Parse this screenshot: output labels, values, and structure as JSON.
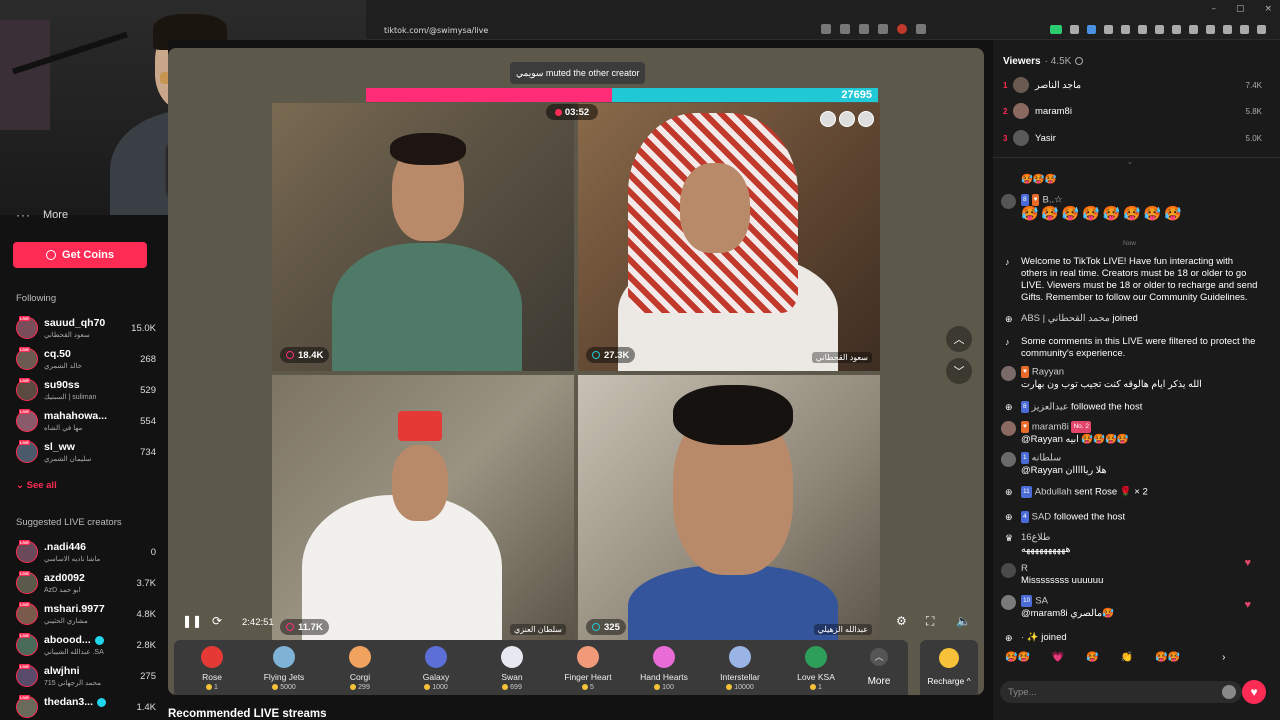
{
  "browser": {
    "url": "tiktok.com/@swimysa/live",
    "minimize": "–",
    "restore": "▢",
    "close": "×"
  },
  "sidebar": {
    "more_label": "More",
    "get_coins": "Get Coins",
    "following_title": "Following",
    "following": [
      {
        "name": "sauud_qh70",
        "sub": "سعود القحطاني",
        "count": "15.0K"
      },
      {
        "name": "cq.50",
        "sub": "خالد الشمري",
        "count": "268"
      },
      {
        "name": "su90ss",
        "sub": "السبتيك | suliman",
        "count": "529"
      },
      {
        "name": "mahahowa...",
        "sub": "مها في الشاه",
        "count": "554"
      },
      {
        "name": "sl_ww",
        "sub": "سليمان الشمري",
        "count": "734"
      }
    ],
    "see_all": "See all",
    "suggested_title": "Suggested LIVE creators",
    "suggested": [
      {
        "name": ".nadi446",
        "sub": "ماشا ناديه الاساسي",
        "count": "0"
      },
      {
        "name": "azd0092",
        "sub": "AzD ابو حمد",
        "count": "3.7K"
      },
      {
        "name": "mshari.9977",
        "sub": "مشاري الحثيني",
        "count": "4.8K"
      },
      {
        "name": "aboood...",
        "sub": "عبدالله الشيباني .SA",
        "count": "2.8K"
      },
      {
        "name": "alwjhni",
        "sub": "715 محمد الرجهاني",
        "count": "275"
      },
      {
        "name": "thedan3...",
        "sub": "",
        "count": "1.4K"
      }
    ]
  },
  "live": {
    "muted_tip": "سويمي muted the other creator",
    "right_score": "27695",
    "timer": "03:52",
    "cells": [
      {
        "viewers": "18.4K",
        "tag": ""
      },
      {
        "viewers": "27.3K",
        "tag": "سعود القحطاني"
      },
      {
        "viewers": "11.7K",
        "tag": "سلطان العنزي"
      },
      {
        "viewers": "325",
        "tag": "عبدالله الزهيلي"
      }
    ],
    "elapsed": "2:42:51",
    "gifts": [
      {
        "name": "Rose",
        "price": "1",
        "color": "#e53935"
      },
      {
        "name": "Flying Jets",
        "price": "5000",
        "color": "#7fb3d5"
      },
      {
        "name": "Corgi",
        "price": "299",
        "color": "#f0a35e"
      },
      {
        "name": "Galaxy",
        "price": "1000",
        "color": "#5b6fd6"
      },
      {
        "name": "Swan",
        "price": "699",
        "color": "#e8e8f0"
      },
      {
        "name": "Finger Heart",
        "price": "5",
        "color": "#f09a7a"
      },
      {
        "name": "Hand Hearts",
        "price": "100",
        "color": "#e86bd6"
      },
      {
        "name": "Interstellar",
        "price": "10000",
        "color": "#9ab4e6"
      },
      {
        "name": "Love KSA",
        "price": "1",
        "color": "#2e9e5b"
      }
    ],
    "more_label": "More",
    "recharge_label": "Recharge ^",
    "recommended_title": "Recommended LIVE streams"
  },
  "chat": {
    "viewers_label": "Viewers",
    "viewers_count": "· 4.5K",
    "ranking": [
      {
        "pos": "1",
        "name": "ماجد الناصر",
        "score": "7.4K"
      },
      {
        "pos": "2",
        "name": "maram8i",
        "score": "5.8K"
      },
      {
        "pos": "3",
        "name": "Yasir",
        "score": "5.0K"
      }
    ],
    "now_label": "Now",
    "msg_emoji_top": "🥵🥵🥵",
    "msg_b_user": "B..☆",
    "msg_b_emojis": "🥵🥵🥵🥵🥵🥵🥵🥵",
    "welcome": "Welcome to TikTok LIVE! Have fun interacting with others in real time. Creators must be 18 or older to go LIVE. Viewers must be 18 or older to recharge and send Gifts. Remember to follow our Community Guidelines.",
    "join1_user": "ABS | محمد القحطاني",
    "join1_action": "joined",
    "filtered": "Some comments in this LIVE were filtered to protect the community's experience.",
    "rayyan_user": "Rayyan",
    "rayyan_msg": "الله يذكر ايام هالوقه كنت تجيب توب ون بهارت",
    "azeez_user": "عبدالعزيز",
    "azeez_action": "followed the host",
    "maram_user": "maram8i",
    "maram_badge": "No. 2",
    "maram_msg": "@Rayyan ابيه 🥵🥵🥵🥵",
    "sultana_user": "سلطانه",
    "sultana_msg": "@Rayyan هلا ريااااان",
    "abdullah_user": "Abdullah",
    "abdullah_action": "sent Rose 🌹 × 2",
    "sad_user": "SAD",
    "sad_action": "followed the host",
    "talaa_user": "طلاع16",
    "talaa_msg": "ههههههههههه",
    "r_user": "R",
    "r_msg": "Missssssss uuuuuu",
    "sa_user": "SA",
    "sa_msg": "@maram8i مالصري🥵",
    "last_join_action": "joined",
    "quick_emojis": [
      "🥵🥵",
      "💗",
      "🥵",
      "👏",
      "🥵🥵"
    ],
    "type_placeholder": "Type..."
  },
  "colors": {
    "accent": "#fe2c55",
    "pk_pink": "#fe2c77",
    "pk_cyan": "#21c8d5"
  }
}
